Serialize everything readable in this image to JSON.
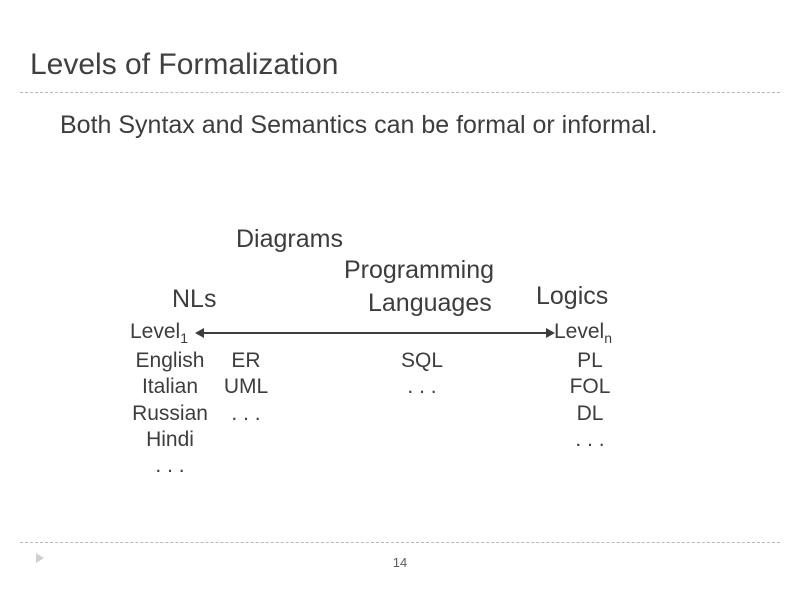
{
  "title": "Levels of Formalization",
  "subtitle": "Both Syntax and Semantics can be formal or informal.",
  "labels": {
    "diagrams": "Diagrams",
    "nls": "NLs",
    "programming": "Programming",
    "languages": "Languages",
    "logics": "Logics"
  },
  "levels": {
    "left_base": "Level",
    "left_sub": "1",
    "right_base": "Level",
    "right_sub": "n"
  },
  "columns": {
    "nls": [
      "English",
      "Italian",
      "Russian",
      "Hindi",
      ". . ."
    ],
    "diagrams": [
      "ER",
      "UML",
      ". . ."
    ],
    "prog": [
      "SQL",
      ". . ."
    ],
    "logics": [
      "PL",
      "FOL",
      "DL",
      ". . ."
    ]
  },
  "page_number": "14"
}
